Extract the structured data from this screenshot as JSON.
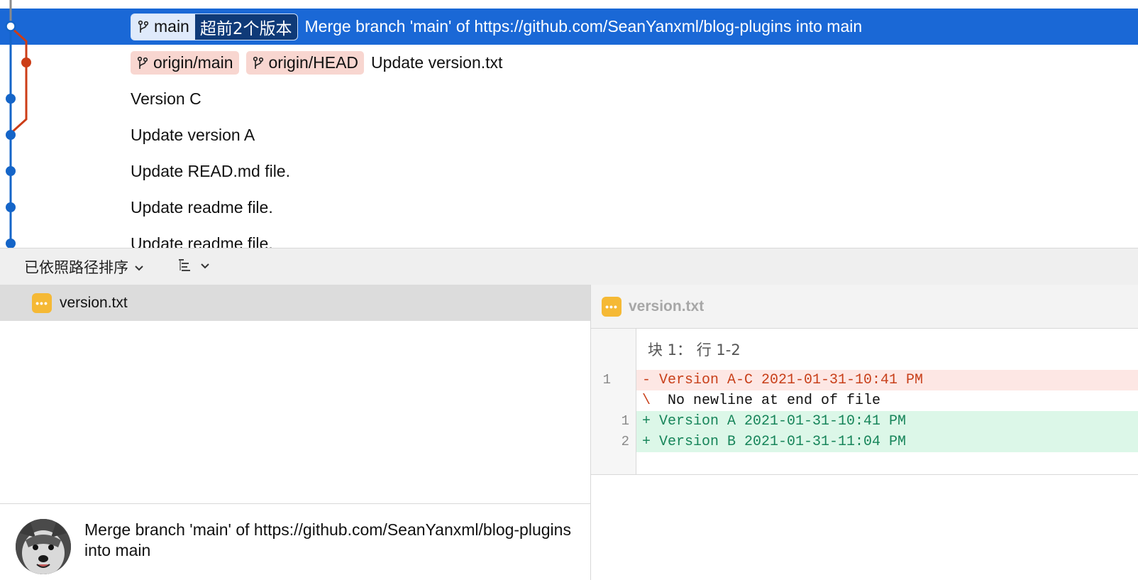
{
  "history": {
    "commits": [
      {
        "message": "Merge branch 'main' of https://github.com/SeanYanxml/blog-plugins into main",
        "selected": true,
        "local_branch": "main",
        "ahead_text": "超前2个版本"
      },
      {
        "message": "Update version.txt",
        "remote_refs": [
          "origin/main",
          "origin/HEAD"
        ]
      },
      {
        "message": "Version C"
      },
      {
        "message": "Update version A"
      },
      {
        "message": "Update READ.md file."
      },
      {
        "message": "Update readme file."
      },
      {
        "message": "Update readme file."
      }
    ],
    "graph_colors": {
      "main_line": "#1565c8",
      "merged_line": "#cc3d17",
      "selected_node": "#ffffff"
    }
  },
  "toolbar": {
    "sort_label": "已依照路径排序",
    "view_icon": "list-tree-icon"
  },
  "file_list": {
    "files": [
      {
        "name": "version.txt",
        "status_icon": "modified-file-icon"
      }
    ]
  },
  "commit_detail": {
    "message": "Merge branch 'main' of https://github.com/SeanYanxml/blog-plugins into main"
  },
  "diff": {
    "file_name": "version.txt",
    "hunk_header": "块 1： 行 1-2",
    "lines": [
      {
        "type": "removed",
        "old": "1",
        "new": "",
        "mark": "-",
        "text": "Version A-C 2021-01-31-10:41 PM"
      },
      {
        "type": "noeol",
        "old": "",
        "new": "",
        "mark": "\\",
        "text": "No newline at end of file"
      },
      {
        "type": "added",
        "old": "",
        "new": "1",
        "mark": "+",
        "text": "Version A 2021-01-31-10:41 PM"
      },
      {
        "type": "added",
        "old": "",
        "new": "2",
        "mark": "+",
        "text": "Version B 2021-01-31-11:04 PM"
      }
    ]
  },
  "colors": {
    "selection": "#1a68d6",
    "remote_badge": "#f8d6d0",
    "local_badge": "#dfeafb",
    "ahead_badge": "#0f3a78",
    "removed_bg": "#fde7e4",
    "added_bg": "#dcf7e8",
    "file_icon": "#f5b935"
  }
}
